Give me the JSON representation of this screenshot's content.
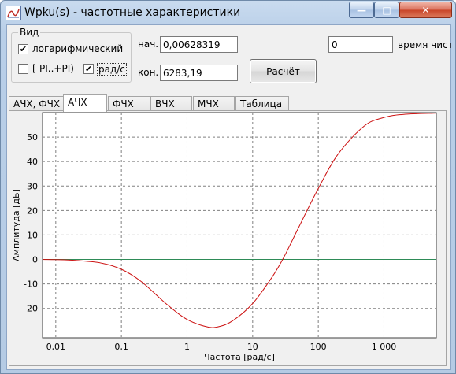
{
  "window": {
    "title": "Wpku(s) - частотные характеристики",
    "buttons": {
      "minimize": "—",
      "maximize": "□",
      "close": "✕"
    }
  },
  "view_group": {
    "title": "Вид",
    "log_checkbox": {
      "label": "логарифмический",
      "checked": true
    },
    "pi_checkbox": {
      "label": "[-PI..+PI)",
      "checked": false
    },
    "rad_checkbox": {
      "label": "рад/с",
      "checked": true
    }
  },
  "range": {
    "start_label": "нач.",
    "start_value": "0,00628319",
    "end_label": "кон.",
    "end_value": "6283,19"
  },
  "calc_button": "Расчёт",
  "time": {
    "value": "0",
    "label": "время чист"
  },
  "tabs": [
    {
      "label": "АЧХ, ФЧХ",
      "active": false
    },
    {
      "label": "АЧХ",
      "active": true
    },
    {
      "label": "ФЧХ",
      "active": false
    },
    {
      "label": "ВЧХ",
      "active": false
    },
    {
      "label": "МЧХ",
      "active": false
    },
    {
      "label": "Таблица",
      "active": false
    }
  ],
  "chart_data": {
    "type": "line",
    "xlabel": "Частота [рад/с]",
    "ylabel": "Амплитуда [дБ]",
    "x_scale": "log",
    "xlim": [
      0.00628319,
      6283.19
    ],
    "ylim": [
      -32,
      60
    ],
    "x_ticks": [
      0.01,
      0.1,
      1,
      10,
      100,
      1000
    ],
    "x_tick_labels": [
      "0,01",
      "0,1",
      "1",
      "10",
      "100",
      "1 000"
    ],
    "y_ticks": [
      -20,
      -10,
      0,
      10,
      20,
      30,
      40,
      50
    ],
    "y_tick_labels": [
      "-20",
      "-10",
      "0",
      "10",
      "20",
      "30",
      "40",
      "50"
    ],
    "grid": true,
    "zero_line": {
      "y": 0,
      "color": "#2e8b57"
    },
    "series": [
      {
        "color": "#cc1111",
        "points": [
          [
            0.00628,
            0
          ],
          [
            0.01,
            -0.1
          ],
          [
            0.02,
            -0.4
          ],
          [
            0.05,
            -1.5
          ],
          [
            0.1,
            -4
          ],
          [
            0.2,
            -9
          ],
          [
            0.5,
            -18.5
          ],
          [
            1,
            -24.5
          ],
          [
            2,
            -27.5
          ],
          [
            3,
            -27.5
          ],
          [
            5,
            -25
          ],
          [
            10,
            -18
          ],
          [
            20,
            -7
          ],
          [
            30,
            1
          ],
          [
            50,
            13
          ],
          [
            100,
            29
          ],
          [
            200,
            43
          ],
          [
            500,
            54.5
          ],
          [
            1000,
            58
          ],
          [
            2000,
            59.3
          ],
          [
            6283,
            59.8
          ]
        ]
      }
    ]
  }
}
